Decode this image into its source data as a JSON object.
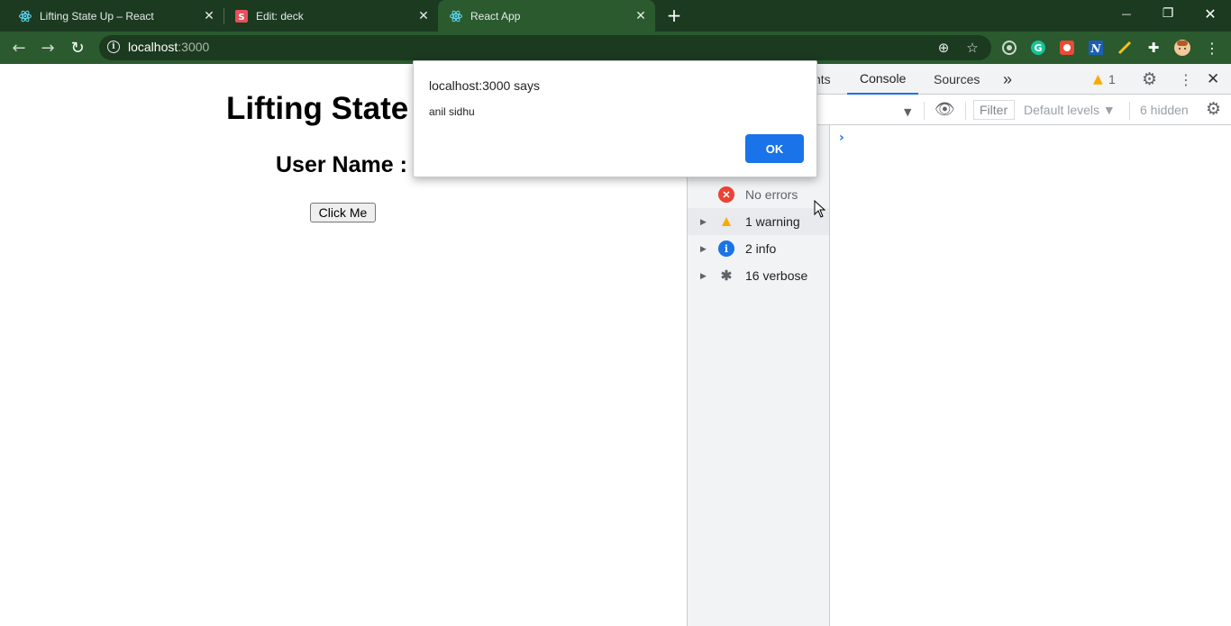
{
  "browser": {
    "tabs": [
      {
        "title": "Lifting State Up – React",
        "close": "✕"
      },
      {
        "title": "Edit: deck",
        "close": "✕"
      },
      {
        "title": "React App",
        "close": "✕"
      }
    ],
    "new_tab": "+",
    "window_controls": {
      "minimize": "—",
      "restore": "❐",
      "close": "✕"
    },
    "url_host": "localhost",
    "url_port": ":3000"
  },
  "page": {
    "heading": "Lifting State",
    "subheading": "User Name :",
    "button_label": "Click Me"
  },
  "devtools": {
    "tabs": {
      "partial": "nts",
      "console": "Console",
      "sources": "Sources",
      "more": "»"
    },
    "warning_count": "1",
    "filter_placeholder": "Filter",
    "levels": "Default levels ▼",
    "hidden": "6 hidden",
    "sidebar": [
      {
        "label": "No errors",
        "icon": "error-icon",
        "color": "#ea4335"
      },
      {
        "label": "1 warning",
        "icon": "warning-icon",
        "color": "#f9ab00"
      },
      {
        "label": "2 info",
        "icon": "info-icon",
        "color": "#1a73e8"
      },
      {
        "label": "16 verbose",
        "icon": "verbose-icon",
        "color": "#5f6368"
      }
    ],
    "prompt": "›"
  },
  "alert": {
    "title": "localhost:3000 says",
    "message": "anil sidhu",
    "ok_label": "OK"
  },
  "colors": {
    "tabstrip": "#1b3a20",
    "toolbar": "#2a5a2e",
    "accent": "#1a73e8"
  }
}
